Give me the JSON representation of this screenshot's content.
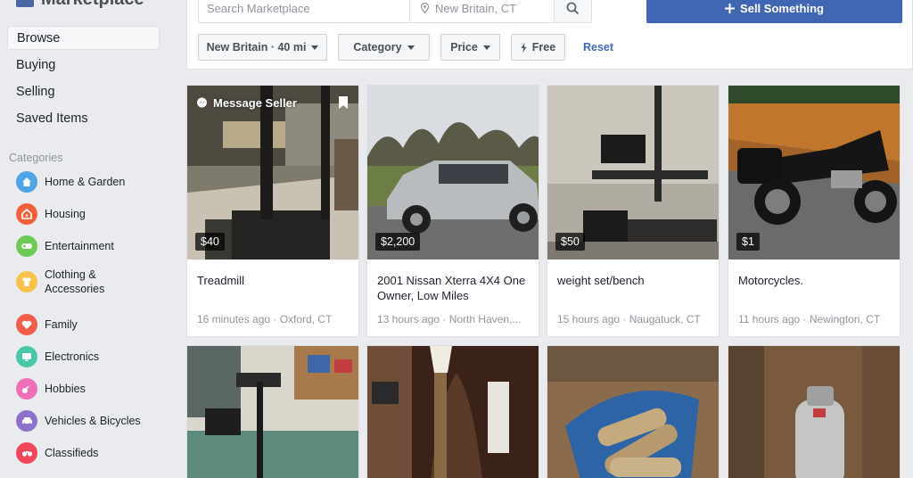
{
  "sidebar": {
    "brand": "Marketplace",
    "nav": [
      {
        "label": "Browse",
        "active": true
      },
      {
        "label": "Buying"
      },
      {
        "label": "Selling"
      },
      {
        "label": "Saved Items"
      }
    ],
    "categories_heading": "Categories",
    "categories": [
      {
        "label": "Home & Garden",
        "color": "#4fa3e6",
        "icon": "house-icon"
      },
      {
        "label": "Housing",
        "color": "#f4603e",
        "icon": "home-key-icon"
      },
      {
        "label": "Entertainment",
        "color": "#6bcb55",
        "icon": "gamepad-icon"
      },
      {
        "label": "Clothing & Accessories",
        "color": "#f7c34a",
        "icon": "shirt-icon"
      },
      {
        "label": "Family",
        "color": "#f35b4a",
        "icon": "heart-icon"
      },
      {
        "label": "Electronics",
        "color": "#49c6a7",
        "icon": "monitor-icon"
      },
      {
        "label": "Hobbies",
        "color": "#ec6fb8",
        "icon": "guitar-icon"
      },
      {
        "label": "Vehicles & Bicycles",
        "color": "#8c72cb",
        "icon": "car-icon"
      },
      {
        "label": "Classifieds",
        "color": "#f0475a",
        "icon": "binoculars-icon"
      }
    ]
  },
  "topbar": {
    "search_placeholder": "Search Marketplace",
    "location": "New Britain, CT",
    "sell_label": "Sell Something",
    "filters": {
      "radius": "New Britain · 40 mi",
      "category": "Category",
      "price": "Price",
      "free": "Free",
      "reset": "Reset"
    }
  },
  "listings": [
    {
      "price": "$40",
      "title": "Treadmill",
      "meta": "16 minutes ago · Oxford, CT",
      "hover_action": "Message Seller"
    },
    {
      "price": "$2,200",
      "title": "2001 Nissan Xterra 4X4 One Owner, Low Miles",
      "meta": "13 hours ago · North Haven,..."
    },
    {
      "price": "$50",
      "title": "weight set/bench",
      "meta": "15 hours ago · Naugatuck, CT"
    },
    {
      "price": "$1",
      "title": "Motorcycles.",
      "meta": "11 hours ago · Newington, CT"
    },
    {
      "price": "",
      "title": "",
      "meta": ""
    },
    {
      "price": "",
      "title": "",
      "meta": ""
    },
    {
      "price": "",
      "title": "",
      "meta": ""
    },
    {
      "price": "",
      "title": "",
      "meta": ""
    }
  ],
  "colors": {
    "accent": "#4267b2",
    "sidebar_bg": "#e9ebee"
  }
}
